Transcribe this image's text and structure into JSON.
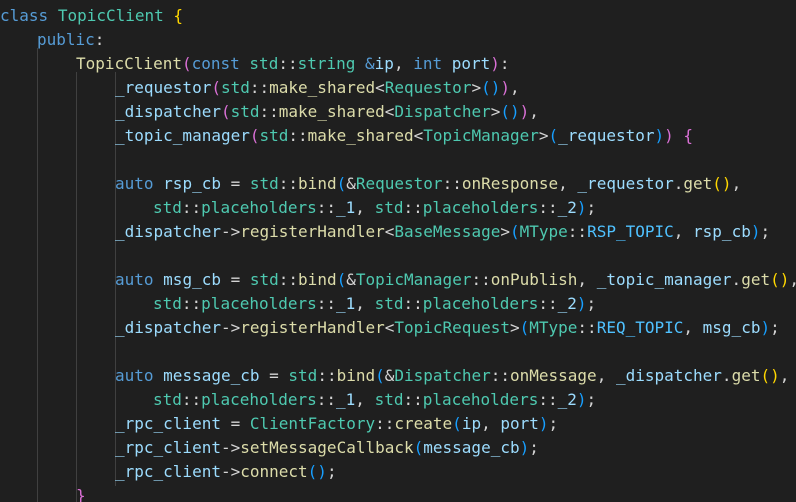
{
  "editor": {
    "language": "cpp",
    "colors": {
      "background": "#1f1f1f",
      "keyword": "#569cd6",
      "type": "#4ec9b0",
      "function": "#dcdcaa",
      "variable": "#9cdcfe",
      "punctuation": "#d4d4d4",
      "enum_member": "#4fc1ff",
      "bracket_level_1": "#ffd700",
      "bracket_level_2": "#da70d6",
      "bracket_level_3": "#179fff"
    },
    "lines": [
      [
        [
          "kw",
          "class"
        ],
        [
          "pu",
          " "
        ],
        [
          "ty",
          "TopicClient"
        ],
        [
          "pu",
          " "
        ],
        [
          "b1",
          "{"
        ]
      ],
      [
        [
          "kw",
          "public"
        ],
        [
          "pu",
          ":"
        ]
      ],
      [
        [
          "fn",
          "TopicClient"
        ],
        [
          "b2",
          "("
        ],
        [
          "kw",
          "const"
        ],
        [
          "pu",
          " "
        ],
        [
          "ty",
          "std"
        ],
        [
          "pu",
          "::"
        ],
        [
          "ty",
          "string"
        ],
        [
          "pu",
          " "
        ],
        [
          "kw",
          "&"
        ],
        [
          "vr",
          "ip"
        ],
        [
          "pu",
          ", "
        ],
        [
          "kw",
          "int"
        ],
        [
          "pu",
          " "
        ],
        [
          "vr",
          "port"
        ],
        [
          "b2",
          ")"
        ],
        [
          "pu",
          ":"
        ]
      ],
      [
        [
          "vr",
          "_requestor"
        ],
        [
          "b2",
          "("
        ],
        [
          "ty",
          "std"
        ],
        [
          "pu",
          "::"
        ],
        [
          "fn",
          "make_shared"
        ],
        [
          "pu",
          "<"
        ],
        [
          "ty",
          "Requestor"
        ],
        [
          "pu",
          ">"
        ],
        [
          "b3",
          "()"
        ],
        [
          "b2",
          ")"
        ],
        [
          "pu",
          ","
        ]
      ],
      [
        [
          "vr",
          "_dispatcher"
        ],
        [
          "b2",
          "("
        ],
        [
          "ty",
          "std"
        ],
        [
          "pu",
          "::"
        ],
        [
          "fn",
          "make_shared"
        ],
        [
          "pu",
          "<"
        ],
        [
          "ty",
          "Dispatcher"
        ],
        [
          "pu",
          ">"
        ],
        [
          "b3",
          "()"
        ],
        [
          "b2",
          ")"
        ],
        [
          "pu",
          ","
        ]
      ],
      [
        [
          "vr",
          "_topic_manager"
        ],
        [
          "b2",
          "("
        ],
        [
          "ty",
          "std"
        ],
        [
          "pu",
          "::"
        ],
        [
          "fn",
          "make_shared"
        ],
        [
          "pu",
          "<"
        ],
        [
          "ty",
          "TopicManager"
        ],
        [
          "pu",
          ">"
        ],
        [
          "b3",
          "("
        ],
        [
          "vr",
          "_requestor"
        ],
        [
          "b3",
          ")"
        ],
        [
          "b2",
          ")"
        ],
        [
          "pu",
          " "
        ],
        [
          "b2",
          "{"
        ]
      ],
      [],
      [
        [
          "kw",
          "auto"
        ],
        [
          "pu",
          " "
        ],
        [
          "vr",
          "rsp_cb"
        ],
        [
          "pu",
          " = "
        ],
        [
          "ty",
          "std"
        ],
        [
          "pu",
          "::"
        ],
        [
          "fn",
          "bind"
        ],
        [
          "b3",
          "("
        ],
        [
          "pu",
          "&"
        ],
        [
          "ty",
          "Requestor"
        ],
        [
          "pu",
          "::"
        ],
        [
          "fn",
          "onResponse"
        ],
        [
          "pu",
          ", "
        ],
        [
          "vr",
          "_requestor"
        ],
        [
          "pu",
          "."
        ],
        [
          "fn",
          "get"
        ],
        [
          "b1",
          "()"
        ],
        [
          "pu",
          ","
        ]
      ],
      [
        [
          "ty",
          "std"
        ],
        [
          "pu",
          "::"
        ],
        [
          "ty",
          "placeholders"
        ],
        [
          "pu",
          "::"
        ],
        [
          "vr",
          "_1"
        ],
        [
          "pu",
          ", "
        ],
        [
          "ty",
          "std"
        ],
        [
          "pu",
          "::"
        ],
        [
          "ty",
          "placeholders"
        ],
        [
          "pu",
          "::"
        ],
        [
          "vr",
          "_2"
        ],
        [
          "b3",
          ")"
        ],
        [
          "pu",
          ";"
        ]
      ],
      [
        [
          "vr",
          "_dispatcher"
        ],
        [
          "pu",
          "->"
        ],
        [
          "fn",
          "registerHandler"
        ],
        [
          "pu",
          "<"
        ],
        [
          "ty",
          "BaseMessage"
        ],
        [
          "pu",
          ">"
        ],
        [
          "b3",
          "("
        ],
        [
          "ty",
          "MType"
        ],
        [
          "pu",
          "::"
        ],
        [
          "en",
          "RSP_TOPIC"
        ],
        [
          "pu",
          ", "
        ],
        [
          "vr",
          "rsp_cb"
        ],
        [
          "b3",
          ")"
        ],
        [
          "pu",
          ";"
        ]
      ],
      [],
      [
        [
          "kw",
          "auto"
        ],
        [
          "pu",
          " "
        ],
        [
          "vr",
          "msg_cb"
        ],
        [
          "pu",
          " = "
        ],
        [
          "ty",
          "std"
        ],
        [
          "pu",
          "::"
        ],
        [
          "fn",
          "bind"
        ],
        [
          "b3",
          "("
        ],
        [
          "pu",
          "&"
        ],
        [
          "ty",
          "TopicManager"
        ],
        [
          "pu",
          "::"
        ],
        [
          "fn",
          "onPublish"
        ],
        [
          "pu",
          ", "
        ],
        [
          "vr",
          "_topic_manager"
        ],
        [
          "pu",
          "."
        ],
        [
          "fn",
          "get"
        ],
        [
          "b1",
          "()"
        ],
        [
          "pu",
          ","
        ]
      ],
      [
        [
          "ty",
          "std"
        ],
        [
          "pu",
          "::"
        ],
        [
          "ty",
          "placeholders"
        ],
        [
          "pu",
          "::"
        ],
        [
          "vr",
          "_1"
        ],
        [
          "pu",
          ", "
        ],
        [
          "ty",
          "std"
        ],
        [
          "pu",
          "::"
        ],
        [
          "ty",
          "placeholders"
        ],
        [
          "pu",
          "::"
        ],
        [
          "vr",
          "_2"
        ],
        [
          "b3",
          ")"
        ],
        [
          "pu",
          ";"
        ]
      ],
      [
        [
          "vr",
          "_dispatcher"
        ],
        [
          "pu",
          "->"
        ],
        [
          "fn",
          "registerHandler"
        ],
        [
          "pu",
          "<"
        ],
        [
          "ty",
          "TopicRequest"
        ],
        [
          "pu",
          ">"
        ],
        [
          "b3",
          "("
        ],
        [
          "ty",
          "MType"
        ],
        [
          "pu",
          "::"
        ],
        [
          "en",
          "REQ_TOPIC"
        ],
        [
          "pu",
          ", "
        ],
        [
          "vr",
          "msg_cb"
        ],
        [
          "b3",
          ")"
        ],
        [
          "pu",
          ";"
        ]
      ],
      [],
      [
        [
          "kw",
          "auto"
        ],
        [
          "pu",
          " "
        ],
        [
          "vr",
          "message_cb"
        ],
        [
          "pu",
          " = "
        ],
        [
          "ty",
          "std"
        ],
        [
          "pu",
          "::"
        ],
        [
          "fn",
          "bind"
        ],
        [
          "b3",
          "("
        ],
        [
          "pu",
          "&"
        ],
        [
          "ty",
          "Dispatcher"
        ],
        [
          "pu",
          "::"
        ],
        [
          "fn",
          "onMessage"
        ],
        [
          "pu",
          ", "
        ],
        [
          "vr",
          "_dispatcher"
        ],
        [
          "pu",
          "."
        ],
        [
          "fn",
          "get"
        ],
        [
          "b1",
          "()"
        ],
        [
          "pu",
          ","
        ]
      ],
      [
        [
          "ty",
          "std"
        ],
        [
          "pu",
          "::"
        ],
        [
          "ty",
          "placeholders"
        ],
        [
          "pu",
          "::"
        ],
        [
          "vr",
          "_1"
        ],
        [
          "pu",
          ", "
        ],
        [
          "ty",
          "std"
        ],
        [
          "pu",
          "::"
        ],
        [
          "ty",
          "placeholders"
        ],
        [
          "pu",
          "::"
        ],
        [
          "vr",
          "_2"
        ],
        [
          "b3",
          ")"
        ],
        [
          "pu",
          ";"
        ]
      ],
      [
        [
          "vr",
          "_rpc_client"
        ],
        [
          "pu",
          " = "
        ],
        [
          "ty",
          "ClientFactory"
        ],
        [
          "pu",
          "::"
        ],
        [
          "fn",
          "create"
        ],
        [
          "b3",
          "("
        ],
        [
          "vr",
          "ip"
        ],
        [
          "pu",
          ", "
        ],
        [
          "vr",
          "port"
        ],
        [
          "b3",
          ")"
        ],
        [
          "pu",
          ";"
        ]
      ],
      [
        [
          "vr",
          "_rpc_client"
        ],
        [
          "pu",
          "->"
        ],
        [
          "fn",
          "setMessageCallback"
        ],
        [
          "b3",
          "("
        ],
        [
          "vr",
          "message_cb"
        ],
        [
          "b3",
          ")"
        ],
        [
          "pu",
          ";"
        ]
      ],
      [
        [
          "vr",
          "_rpc_client"
        ],
        [
          "pu",
          "->"
        ],
        [
          "fn",
          "connect"
        ],
        [
          "b3",
          "()"
        ],
        [
          "pu",
          ";"
        ]
      ],
      [
        [
          "b2",
          "}"
        ]
      ]
    ]
  }
}
